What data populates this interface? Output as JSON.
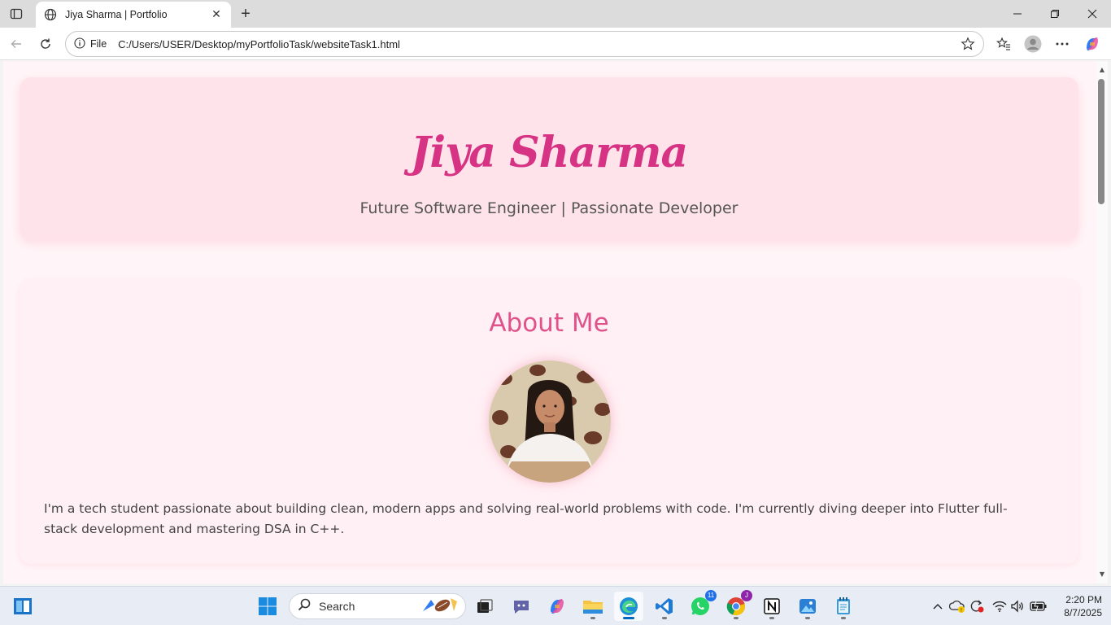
{
  "browser": {
    "tab_title": "Jiya Sharma | Portfolio",
    "address_scheme_label": "File",
    "address_url": "C:/Users/USER/Desktop/myPortfolioTask/websiteTask1.html"
  },
  "page": {
    "hero": {
      "name": "Jiya Sharma",
      "tagline": "Future Software Engineer | Passionate Developer"
    },
    "about": {
      "heading": "About Me",
      "bio": "I'm a tech student passionate about building clean, modern apps and solving real-world problems with code. I'm currently diving deeper into Flutter full-stack development and mastering DSA in C++."
    }
  },
  "taskbar": {
    "search_label": "Search",
    "whatsapp_badge": "11",
    "chrome_badge": "J",
    "time": "2:20 PM",
    "date": "8/7/2025"
  },
  "colors": {
    "accent_pink": "#d63384",
    "hero_bg": "#ffe3ea",
    "heading_pink": "#e0528a"
  }
}
